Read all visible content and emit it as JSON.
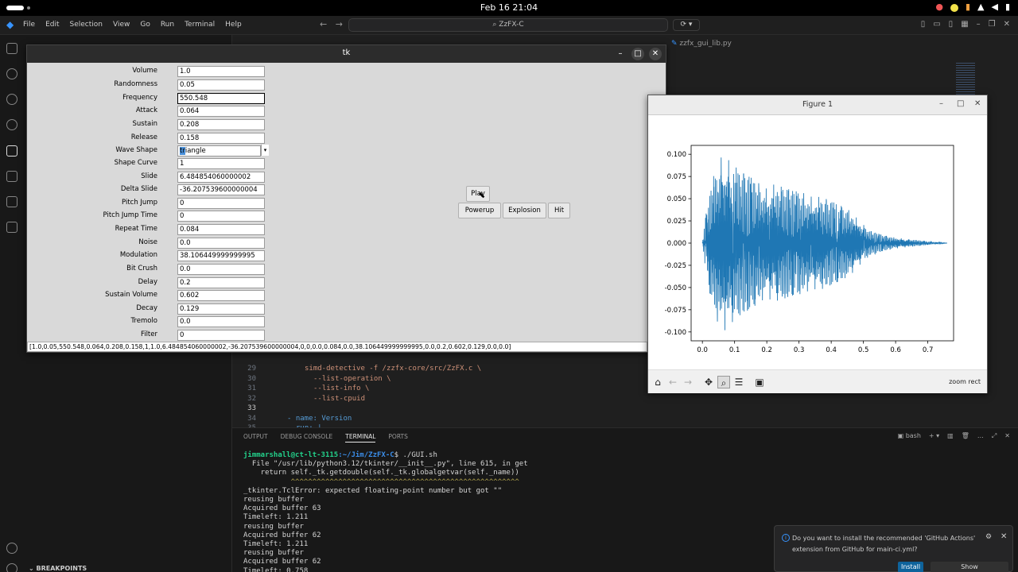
{
  "topbar": {
    "clock": "Feb 16  21:04"
  },
  "vscode": {
    "menu": [
      "File",
      "Edit",
      "Selection",
      "View",
      "Go",
      "Run",
      "Terminal",
      "Help"
    ],
    "search": "ZzFX-C",
    "editor_tab": "zzfx_gui_lib.py",
    "sidebar_section": "BREAKPOINTS",
    "code_lines": [
      {
        "n": "29",
        "text": "simd-detective -f /zzfx-core/src/ZzFX.c \\",
        "style": "str",
        "indent": "      "
      },
      {
        "n": "30",
        "text": "--list-operation \\",
        "style": "str",
        "indent": "        "
      },
      {
        "n": "31",
        "text": "--list-info \\",
        "style": "str",
        "indent": "        "
      },
      {
        "n": "32",
        "text": "--list-cpuid",
        "style": "str",
        "indent": "        "
      },
      {
        "n": "33",
        "text": "",
        "style": "norm",
        "indent": ""
      },
      {
        "n": "34",
        "text": "- name: Version",
        "style": "kv",
        "indent": "  "
      },
      {
        "n": "35",
        "text": "run: |",
        "style": "kv",
        "indent": "    "
      }
    ],
    "panel_tabs": [
      "OUTPUT",
      "DEBUG CONSOLE",
      "TERMINAL",
      "PORTS"
    ],
    "panel_active": "TERMINAL",
    "terminal_shell": "bash",
    "terminal": {
      "user_host": "jimmarshall@ct-lt-3115",
      "path": ":~/Jim/ZzFX-C",
      "command": "$ ./GUI.sh",
      "lines": [
        "  File \"/usr/lib/python3.12/tkinter/__init__.py\", line 615, in get",
        "    return self._tk.getdouble(self._tk.globalgetvar(self._name))",
        "           ^^^^^^^^^^^^^^^^^^^^^^^^^^^^^^^^^^^^^^^^^^^^^^^^^^^^^",
        "_tkinter.TclError: expected floating-point number but got \"\"",
        "reusing buffer",
        "Acquired buffer 63",
        "Timeleft: 1.211",
        "reusing buffer",
        "Acquired buffer 62",
        "Timeleft: 1.211",
        "reusing buffer",
        "Acquired buffer 62",
        "Timeleft: 0.758"
      ]
    },
    "notification": {
      "message": "Do you want to install the recommended 'GitHub Actions' extension from GitHub for main-ci.yml?",
      "install": "Install",
      "show": "Show Recommendations"
    }
  },
  "tk": {
    "title": "tk",
    "params": [
      {
        "label": "Volume",
        "value": "1.0"
      },
      {
        "label": "Randomness",
        "value": "0.05"
      },
      {
        "label": "Frequency",
        "value": "550.548"
      },
      {
        "label": "Attack",
        "value": "0.064"
      },
      {
        "label": "Sustain",
        "value": "0.208"
      },
      {
        "label": "Release",
        "value": "0.158"
      },
      {
        "label": "Wave Shape",
        "value": "triangle"
      },
      {
        "label": "Shape Curve",
        "value": "1"
      },
      {
        "label": "Slide",
        "value": "6.484854060000002"
      },
      {
        "label": "Delta Slide",
        "value": "-36.207539600000004"
      },
      {
        "label": "Pitch Jump",
        "value": "0"
      },
      {
        "label": "Pitch Jump Time",
        "value": "0"
      },
      {
        "label": "Repeat Time",
        "value": "0.084"
      },
      {
        "label": "Noise",
        "value": "0.0"
      },
      {
        "label": "Modulation",
        "value": "38.106449999999995"
      },
      {
        "label": "Bit Crush",
        "value": "0.0"
      },
      {
        "label": "Delay",
        "value": "0.2"
      },
      {
        "label": "Sustain Volume",
        "value": "0.602"
      },
      {
        "label": "Decay",
        "value": "0.129"
      },
      {
        "label": "Tremolo",
        "value": "0.0"
      },
      {
        "label": "Filter",
        "value": "0"
      }
    ],
    "buttons": {
      "play": "Play",
      "powerup": "Powerup",
      "explosion": "Explosion",
      "hit": "Hit"
    },
    "status": "[1.0,0.05,550.548,0.064,0.208,0.158,1,1.0,6.484854060000002,-36.207539600000004,0,0,0.0,0.084,0.0,38.106449999999995,0.0,0.2,0.602,0.129,0.0,0.0]"
  },
  "figure": {
    "title": "Figure 1",
    "toolbar_status": "zoom rect",
    "toolbar_icons": [
      "home-icon",
      "back-icon",
      "forward-icon",
      "pan-icon",
      "zoom-icon",
      "configure-icon",
      "save-icon"
    ]
  },
  "chart_data": {
    "type": "line",
    "title": "",
    "xlabel": "",
    "ylabel": "",
    "xlim": [
      -0.035,
      0.78
    ],
    "ylim": [
      -0.11,
      0.11
    ],
    "xticks": [
      "0.0",
      "0.1",
      "0.2",
      "0.3",
      "0.4",
      "0.5",
      "0.6",
      "0.7"
    ],
    "yticks": [
      "-0.100",
      "-0.075",
      "-0.050",
      "-0.025",
      "0.000",
      "0.025",
      "0.050",
      "0.075",
      "0.100"
    ],
    "color": "#1f77b4",
    "series": [
      {
        "name": "",
        "envelope_t": [
          0.0,
          0.01,
          0.03,
          0.05,
          0.065,
          0.09,
          0.12,
          0.15,
          0.18,
          0.2,
          0.22,
          0.25,
          0.28,
          0.31,
          0.34,
          0.37,
          0.4,
          0.43,
          0.46,
          0.49,
          0.52,
          0.56,
          0.6,
          0.65,
          0.7,
          0.76
        ],
        "envelope_amp": [
          0.0,
          0.03,
          0.07,
          0.092,
          0.1,
          0.09,
          0.08,
          0.074,
          0.066,
          0.061,
          0.066,
          0.063,
          0.059,
          0.057,
          0.052,
          0.052,
          0.047,
          0.042,
          0.036,
          0.024,
          0.014,
          0.009,
          0.006,
          0.004,
          0.002,
          0.0
        ]
      }
    ]
  }
}
